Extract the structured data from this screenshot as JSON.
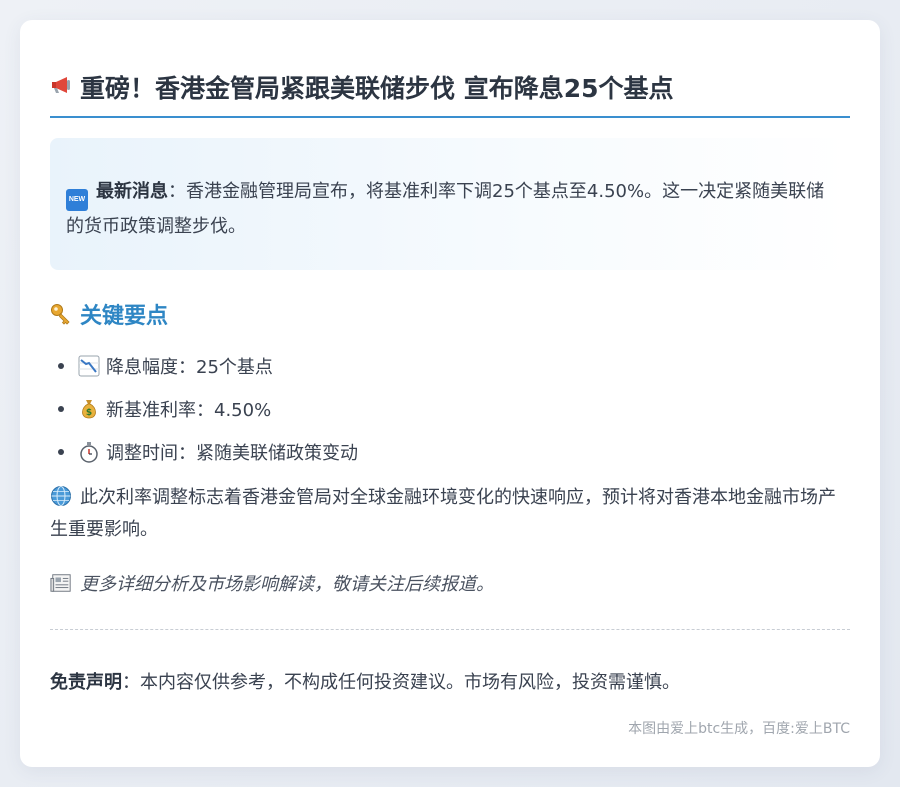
{
  "title": {
    "icon": "megaphone-icon",
    "text": "重磅！香港金管局紧跟美联储步伐 宣布降息25个基点"
  },
  "news": {
    "icon": "new-badge-icon",
    "badge": "NEW",
    "lead": "最新消息",
    "text": "：香港金融管理局宣布，将基准利率下调25个基点至4.50%。这一决定紧随美联储的货币政策调整步伐。"
  },
  "key_points": {
    "icon": "key-icon",
    "title": "关键要点",
    "items": [
      {
        "icon": "chart-decreasing-icon",
        "text": "降息幅度：25个基点"
      },
      {
        "icon": "money-bag-icon",
        "text": "新基准利率：4.50%"
      },
      {
        "icon": "stopwatch-icon",
        "text": "调整时间：紧随美联储政策变动"
      }
    ]
  },
  "paragraph": {
    "icon": "globe-icon",
    "text": "此次利率调整标志着香港金管局对全球金融环境变化的快速响应，预计将对香港本地金融市场产生重要影响。"
  },
  "more": {
    "icon": "newspaper-icon",
    "text": "更多详细分析及市场影响解读，敬请关注后续报道。"
  },
  "disclaimer": {
    "lead": "免责声明",
    "text": "：本内容仅供参考，不构成任何投资建议。市场有风险，投资需谨慎。"
  },
  "footer": {
    "text": "本图由爱上btc生成，百度:爱上BTC"
  },
  "colors": {
    "accent": "#2e86c4",
    "title_underline": "#3a8fcf",
    "text": "#3a4250"
  }
}
